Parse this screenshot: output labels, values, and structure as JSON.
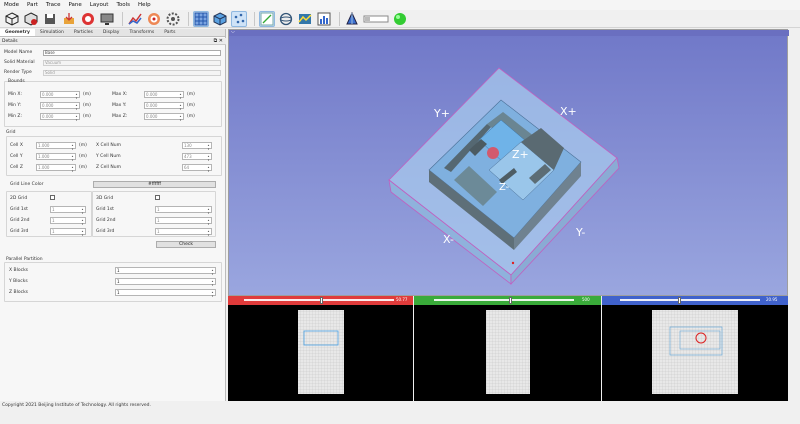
{
  "menu": [
    "Mode",
    "Part",
    "Trace",
    "Pane",
    "Layout",
    "Tools",
    "Help"
  ],
  "tabs": [
    "Geometry",
    "Simulation",
    "Particles",
    "Display",
    "Transforms",
    "Parts"
  ],
  "panel": {
    "title": "Details",
    "name_label": "Model Name",
    "name_value": "Base",
    "solid_label": "Solid Material",
    "solid_value": "Vacuum",
    "render_label": "Render Type",
    "render_value": "Solid",
    "bounds_label": "Bounds",
    "min_x": "Min X:",
    "min_y": "Min Y:",
    "min_z": "Min Z:",
    "max_x": "Max X:",
    "max_y": "Max Y:",
    "max_z": "Max Z:",
    "zero": "0.000",
    "unit": "(m)",
    "grid_label": "Grid",
    "cell_x": "Cell X",
    "cell_y": "Cell Y",
    "cell_z": "Cell Z",
    "cell_val": "1.000",
    "xcell": "X Cell Num",
    "ycell": "Y Cell Num",
    "zcell": "Z Cell Num",
    "xcell_val": "130",
    "ycell_val": "473",
    "zcell_val": "64",
    "grid_line_color": "Grid Line Color",
    "color_value": "#ffffff",
    "left_en": "2D Grid",
    "right_en": "3D Grid",
    "g1": "Grid 1st",
    "g2": "Grid 2nd",
    "g3": "Grid 3rd",
    "g4": "Grid 1st",
    "g5": "Grid 2nd",
    "g6": "Grid 3rd",
    "small": "1",
    "check_btn": "Check",
    "partition_label": "Parallel Partition",
    "xblocks": "X Blocks",
    "yblocks": "Y Blocks",
    "zblocks": "Z Blocks",
    "blocks_val": "1"
  },
  "view3d": {
    "head": "⌵",
    "labels": {
      "ypos": "Y+",
      "xpos": "X+",
      "zpos": "Z+",
      "zneg": "Z-",
      "xneg": "X-",
      "yneg": "Y-"
    }
  },
  "slices": {
    "left_num": "50.77",
    "mid_num": "500",
    "right_num": "20.95"
  },
  "colors": {
    "red": "#e03b3b",
    "green": "#3aab3a",
    "blue": "#4062cc"
  },
  "footer": "Copyright 2021 Beijing Institute of Technology. All rights reserved."
}
